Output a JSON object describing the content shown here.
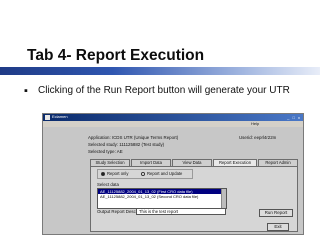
{
  "slide": {
    "title": "Tab 4- Report Execution",
    "bullet_symbol": "▪",
    "bullet_text": "Clicking of the Run Report button will generate your UTR"
  },
  "window": {
    "title": "Eclamen",
    "menu_label": "Help",
    "application": "Application: ICDS UTR (Unique Terms Report)",
    "user": "Userid: eeprl4r22m",
    "selected_study": "Selected study: 111125882 (Test study)",
    "selected_type": "Selected type: AE",
    "tabs": [
      {
        "label": "Study Selection"
      },
      {
        "label": "Import Data"
      },
      {
        "label": "View Data"
      },
      {
        "label": "Report Execution"
      },
      {
        "label": "Report Admin"
      }
    ],
    "active_tab": "Report Execution",
    "radio_report_only": "Report only",
    "radio_report_update": "Report and Update",
    "select_data_label": "Select data",
    "data_rows": [
      "AE_11125882_2004_01_13_02 (First CRO data file)",
      "AE_11125882_2004_01_13_02 (Second CRO data file)"
    ],
    "output_label": "Output Report Description:",
    "output_value": "This is the test report",
    "run_button": "Run Report",
    "exit_button": "Exit"
  }
}
